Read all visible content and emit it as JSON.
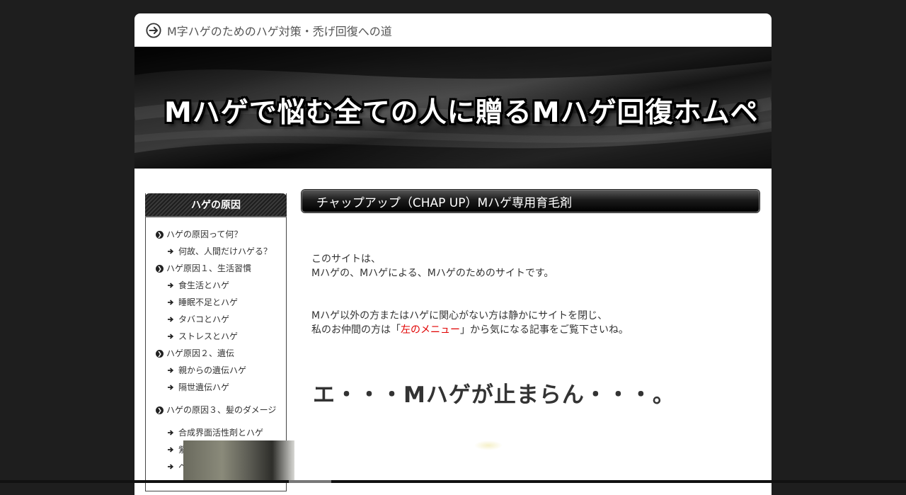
{
  "site": {
    "tagline": "M字ハゲのためのハゲ対策・禿げ回復への道",
    "banner_title": "Mハゲで悩む全ての人に贈るMハゲ回復ホムペ"
  },
  "sidebar": {
    "heading": "ハゲの原因",
    "items": [
      {
        "label": "ハゲの原因って何？",
        "level": 1
      },
      {
        "label": "何故、人間だけハゲる？",
        "level": 2
      },
      {
        "label": "ハゲ原因１、生活習慣",
        "level": 1
      },
      {
        "label": "食生活とハゲ",
        "level": 2
      },
      {
        "label": "睡眠不足とハゲ",
        "level": 2
      },
      {
        "label": "タバコとハゲ",
        "level": 2
      },
      {
        "label": "ストレスとハゲ",
        "level": 2
      },
      {
        "label": "ハゲ原因２、遺伝",
        "level": 1
      },
      {
        "label": "親からの遺伝ハゲ",
        "level": 2
      },
      {
        "label": "隔世遺伝ハゲ",
        "level": 2
      },
      {
        "label": "ハゲの原因３、髪のダメージ",
        "level": 1
      },
      {
        "label": "合成界面活性剤とハゲ",
        "level": 2
      },
      {
        "label": "紫外線とハゲ",
        "level": 2
      },
      {
        "label": "ヘルメットとハゲ",
        "level": 2
      }
    ]
  },
  "main": {
    "heading": "チャップアップ（CHAP UP）Mハゲ専用育毛剤",
    "para1_line1": "このサイトは、",
    "para1_line2": "Mハゲの、Mハゲによる、Mハゲのためのサイトです。",
    "para2_line1": "Mハゲ以外の方またはハゲに関心がない方は静かにサイトを閉じ、",
    "para2_line2_before": "私のお仲間の方は「",
    "para2_link": "左のメニュー",
    "para2_line2_after": "」から気になる記事をご覧下さいね。",
    "big_heading": "エ・・・Mハゲが止まらん・・・。"
  },
  "colors": {
    "background": "#1e1e1e",
    "link_red": "#e00000",
    "text": "#333333"
  }
}
